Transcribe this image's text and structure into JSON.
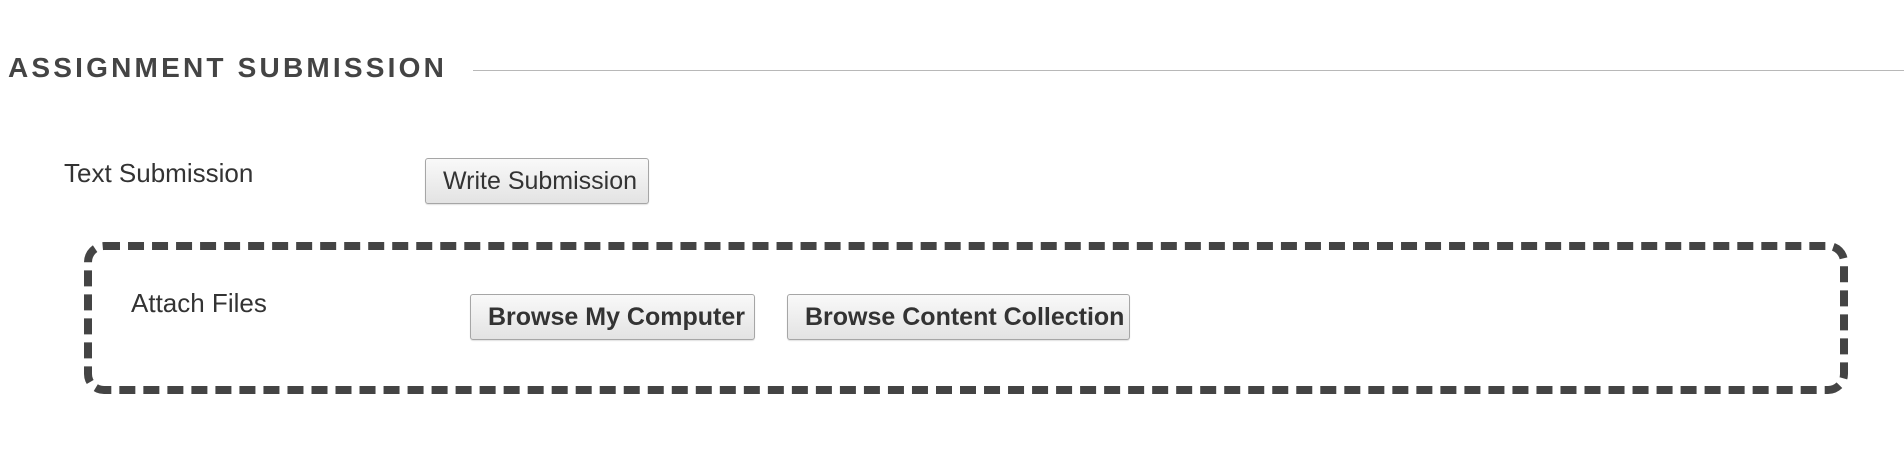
{
  "section": {
    "title": "ASSIGNMENT SUBMISSION"
  },
  "text_submission": {
    "label": "Text Submission",
    "button_label": "Write Submission"
  },
  "attach_files": {
    "label": "Attach Files",
    "browse_computer_label": "Browse My Computer",
    "browse_collection_label": "Browse Content Collection"
  },
  "colors": {
    "heading": "#444444",
    "dashed_border": "#444444",
    "button_border": "#a6a6a6",
    "rule": "#b8b8b8"
  }
}
